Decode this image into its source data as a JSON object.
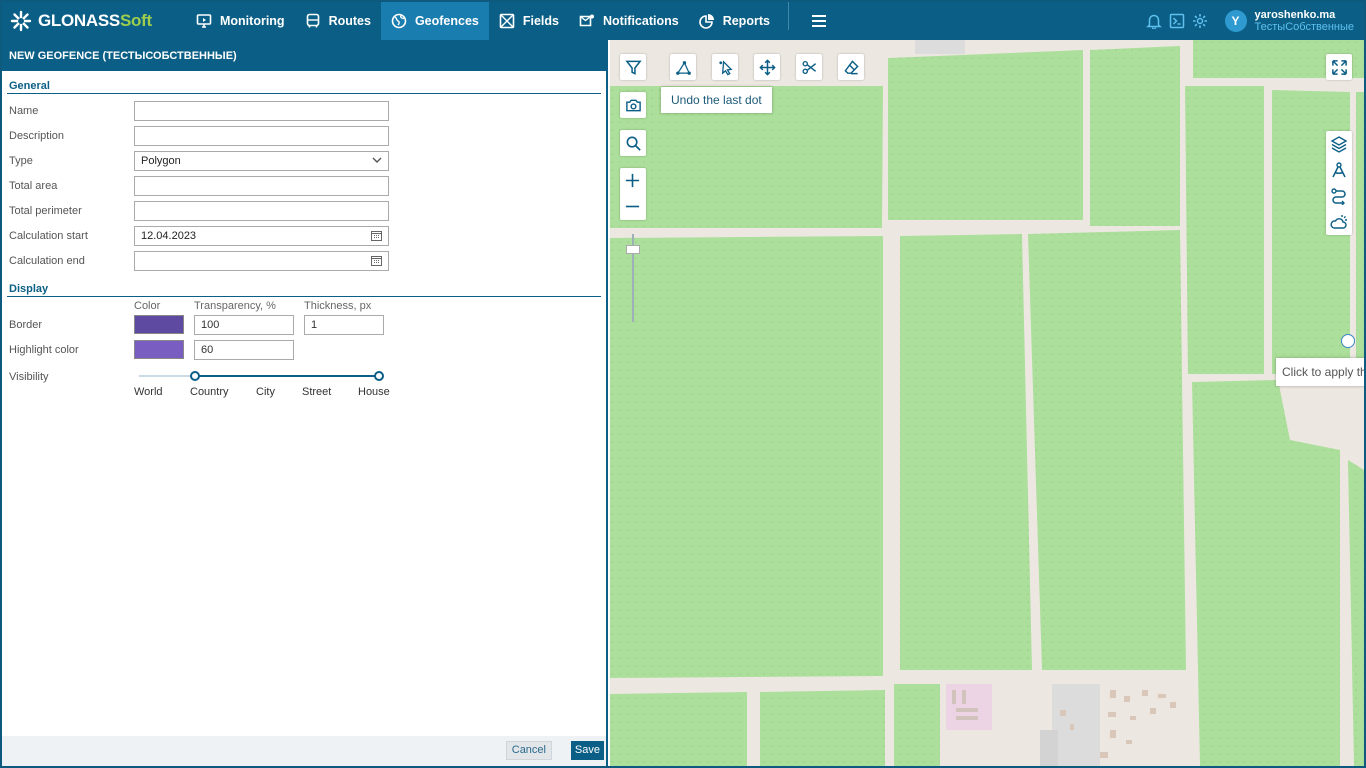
{
  "brand": {
    "name_main": "GLONASS",
    "name_accent": "Soft"
  },
  "nav": [
    {
      "label": "Monitoring",
      "icon": "monitor-icon"
    },
    {
      "label": "Routes",
      "icon": "bus-icon"
    },
    {
      "label": "Geofences",
      "icon": "globe-icon",
      "active": true
    },
    {
      "label": "Fields",
      "icon": "field-icon"
    },
    {
      "label": "Notifications",
      "icon": "envelope-icon"
    },
    {
      "label": "Reports",
      "icon": "pie-chart-icon"
    }
  ],
  "user": {
    "avatar_letter": "Y",
    "name": "yaroshenko.ma",
    "org": "ТестыСобственные"
  },
  "panel": {
    "title": "NEW GEOFENCE (ТЕСТЫСОБСТВЕННЫЕ)",
    "general_label": "General",
    "fields": {
      "name": {
        "label": "Name",
        "value": ""
      },
      "description": {
        "label": "Description",
        "value": ""
      },
      "type": {
        "label": "Type",
        "value": "Polygon"
      },
      "total_area": {
        "label": "Total area",
        "value": ""
      },
      "total_perimeter": {
        "label": "Total perimeter",
        "value": ""
      },
      "calc_start": {
        "label": "Calculation start",
        "value": "12.04.2023"
      },
      "calc_end": {
        "label": "Calculation end",
        "value": ""
      }
    },
    "display_label": "Display",
    "columns": {
      "color": "Color",
      "transparency": "Transparency, %",
      "thickness": "Thickness, px"
    },
    "border": {
      "label": "Border",
      "color": "#5e4aa0",
      "transparency": "100",
      "thickness": "1"
    },
    "highlight": {
      "label": "Highlight color",
      "color": "#7a5dc0",
      "transparency": "60"
    },
    "visibility": {
      "label": "Visibility",
      "levels": [
        "World",
        "Country",
        "City",
        "Street",
        "House"
      ],
      "range_from": "Country",
      "range_to": "House"
    },
    "cancel_label": "Cancel",
    "save_label": "Save"
  },
  "map": {
    "tooltip_undo": "Undo the last dot",
    "tooltip_apply": "Click to apply th",
    "tools": [
      "filter-icon",
      "draw-polygon-icon",
      "pointer-icon",
      "move-icon",
      "scissors-icon",
      "eraser-icon"
    ],
    "side_tools": [
      "camera-icon",
      "search-icon",
      "zoom-in-icon",
      "zoom-out-icon"
    ],
    "right_tools": [
      "layers-icon",
      "compass-icon",
      "route-icon",
      "weather-icon"
    ]
  },
  "colors": {
    "header": "#0b5f86",
    "nav_active": "#1a7db0",
    "field_green": "#acdf9b",
    "road": "#ece8e1"
  }
}
